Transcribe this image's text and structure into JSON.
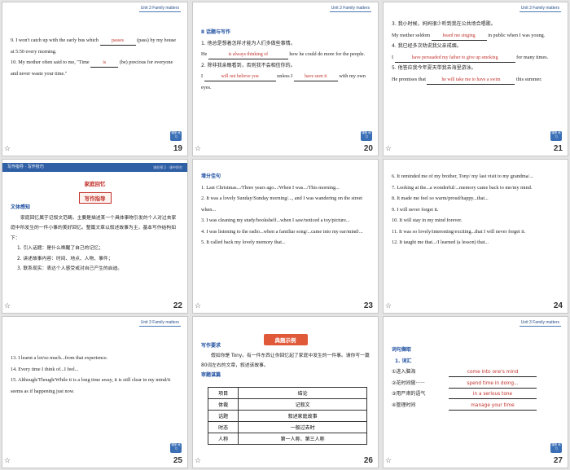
{
  "unit_tag": "Unit 3   Family matters",
  "star_icon": "☆",
  "cube_icon_label": "课堂 练习",
  "slides": [
    {
      "num": "19",
      "lines": [
        {
          "pre": "9. I won't catch up with the early bus which ",
          "ans": "passes",
          "post": " (pass) by my house at 5:50 every morning."
        },
        {
          "pre": "10. My mother often said to me, \"Time ",
          "ans": "is",
          "post": " (be) precious for everyone and never waste your time.\""
        }
      ]
    },
    {
      "num": "20",
      "section": "Ⅱ 话题与写作",
      "items": [
        {
          "zh": "1. 他总是想着怎样才能为人们多做些事情。",
          "pre": "He ",
          "ans": "is always thinking of",
          "post": " how he could do more for the people."
        },
        {
          "zh": "2. 除非我亲眼看到，否则我不会相信你的。",
          "pre": "I ",
          "ans": "will not believe you",
          "mid": " unless I ",
          "ans2": "have seen it",
          "post": " with my own eyes."
        }
      ]
    },
    {
      "num": "21",
      "items": [
        {
          "zh": "3. 我小时候，妈妈很少听到我在公共场合唱歌。",
          "pre": "My mother seldom ",
          "ans": "heard me singing",
          "post": " in public when I was young."
        },
        {
          "zh": "4. 我已经多次劝说我父亲戒烟。",
          "pre": "I ",
          "ans": "have persuaded my father to give up smoking",
          "post": " for many times."
        },
        {
          "zh": "5. 他答应我今年夏天带我去海里游泳。",
          "pre": "He promises that ",
          "ans": "he will take me to have a swim",
          "post": " this summer."
        }
      ]
    },
    {
      "num": "22",
      "band": "写作指导 · 写作技巧",
      "band_right": "课前预习 · 课中探究",
      "topic": "家庭回忆",
      "title": "写作指导",
      "sec_label": "文体感知",
      "para": "家庭回忆属于记叙文范畴。主要是描述某一个具体事物引发的个人对过去家庭中所发生的一件小事的美好回忆。整篇文章以叙述故事为主，基本写作结构如下：",
      "points": [
        "1. 引入话题：是什么唤醒了自己的记忆；",
        "2. 讲述故事内容：时间、地点、人物、事件；",
        "3. 联系现实：表达个人感受或对自己产生的启迪。"
      ]
    },
    {
      "num": "23",
      "section": "增分佳句",
      "lines": [
        "1. Last Christmas.../Three years ago.../When I was.../This morning...",
        "2. It was a lovely Sunday/Sunday morning/..., and I was wandering on the street when...",
        "3. I was cleaning my study/bookshelf...when I saw/noticed a toy/picture...",
        "4. I was listening to the radio...when a familiar song/...came into my ear/mind/...",
        "5. It called back my lovely memory that..."
      ]
    },
    {
      "num": "24",
      "lines": [
        "6. It reminded me of my brother, Tony/ my last visit to my grandma/...",
        "7. Looking at the...a wonderful/...memory came back to me/my mind.",
        "8. It made me feel so warm/proud/happy...that...",
        "9. I will never forget it.",
        "10. It will stay in my mind forever.",
        "11. It was so lovely/interesting/exciting...that I will never forget it.",
        "12. It taught me that.../I learned (a lesson) that..."
      ]
    },
    {
      "num": "25",
      "lines": [
        "13. I learnt a lot/so much...from that experience.",
        "14. Every time I think of...I feel...",
        "15. Although/Though/While it is a long time away, it is still clear in my mind/it seems as if happening just now."
      ]
    },
    {
      "num": "26",
      "ribbon": "典题示例",
      "sec1": "写作要求",
      "req": "假如你是 Tony。有一件东西让你回忆起了家庭中发生的一件事。请你写一篇80词左右的文章，叙述该故事。",
      "sec2": "审题谋篇",
      "table_header": [
        "项目",
        "结论"
      ],
      "table_rows": [
        [
          "体裁",
          "记叙文"
        ],
        [
          "话题",
          "叙述家庭故事"
        ],
        [
          "时态",
          "一般过去时"
        ],
        [
          "人称",
          "第一人称、第三人称"
        ]
      ]
    },
    {
      "num": "27",
      "section": "词句撷取",
      "sub": "1. 词汇",
      "items": [
        {
          "zh": "①进入脑海",
          "ans": "come into one's mind"
        },
        {
          "zh": "②花时间做······",
          "ans": "spend time in doing..."
        },
        {
          "zh": "③用严肃的语气",
          "ans": "in a serious tone"
        },
        {
          "zh": "④管理时间",
          "ans": "manage your time"
        }
      ]
    }
  ]
}
